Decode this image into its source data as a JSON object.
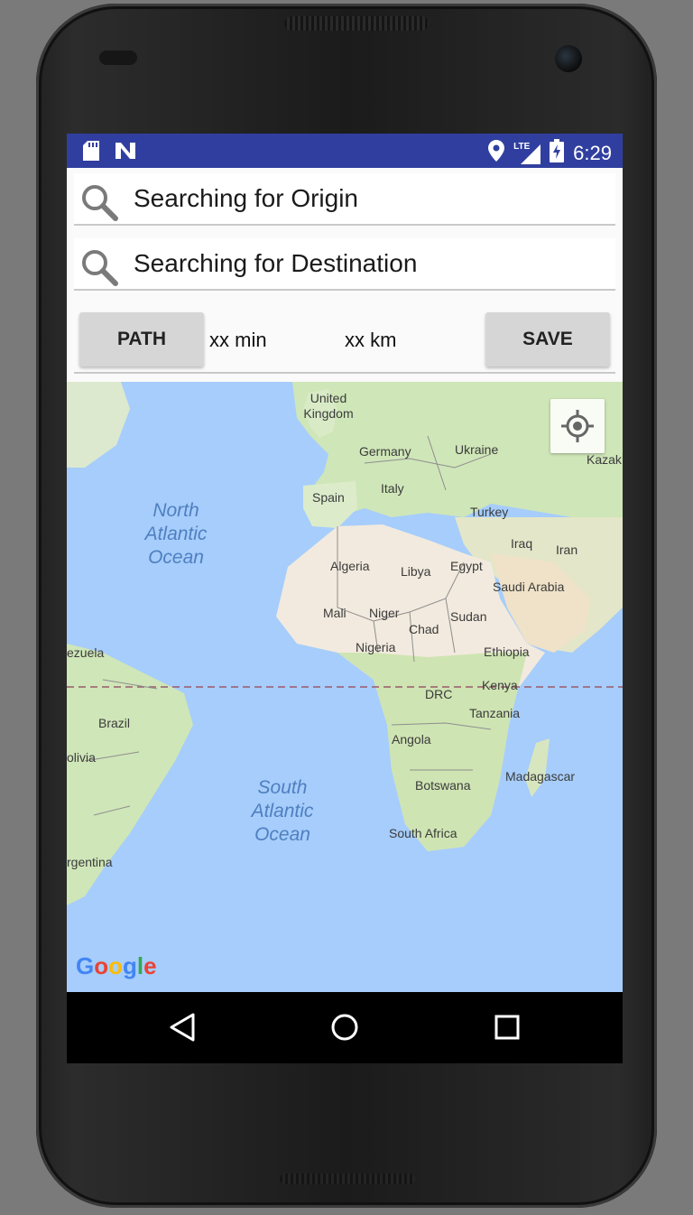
{
  "status_bar": {
    "time": "6:29",
    "network": "LTE",
    "icons": [
      "sd-card-icon",
      "n-notification-icon",
      "location-pin-icon",
      "lte-signal-icon",
      "battery-charging-icon"
    ]
  },
  "origin_search": {
    "icon": "search-icon",
    "text": "Searching for Origin"
  },
  "destination_search": {
    "icon": "search-icon",
    "text": "Searching for Destination"
  },
  "controls": {
    "path_label": "PATH",
    "duration": "xx min",
    "distance": "xx km",
    "save_label": "SAVE"
  },
  "map": {
    "countries": {
      "united_kingdom": "United Kingdom",
      "germany": "Germany",
      "ukraine": "Ukraine",
      "kazak": "Kazak",
      "spain": "Spain",
      "italy": "Italy",
      "turkey": "Turkey",
      "iraq": "Iraq",
      "iran": "Iran",
      "algeria": "Algeria",
      "libya": "Libya",
      "egypt": "Egypt",
      "saudi_arabia": "Saudi Arabia",
      "mali": "Mali",
      "niger": "Niger",
      "sudan": "Sudan",
      "chad": "Chad",
      "nigeria": "Nigeria",
      "ethiopia": "Ethiopia",
      "venezuela": "ezuela",
      "kenya": "Kenya",
      "drc": "DRC",
      "brazil": "Brazil",
      "tanzania": "Tanzania",
      "bolivia": "olivia",
      "angola": "Angola",
      "madagascar": "Madagascar",
      "botswana": "Botswana",
      "south_africa": "South Africa",
      "argentina": "rgentina"
    },
    "oceans": {
      "north_atlantic": "North\nAtlantic\nOcean",
      "south_atlantic": "South\nAtlantic\nOcean"
    },
    "my_location_icon": "my-location-icon",
    "attribution": "Google"
  },
  "navigation": {
    "back_icon": "back-triangle-icon",
    "home_icon": "home-circle-icon",
    "recents_icon": "recents-square-icon"
  }
}
